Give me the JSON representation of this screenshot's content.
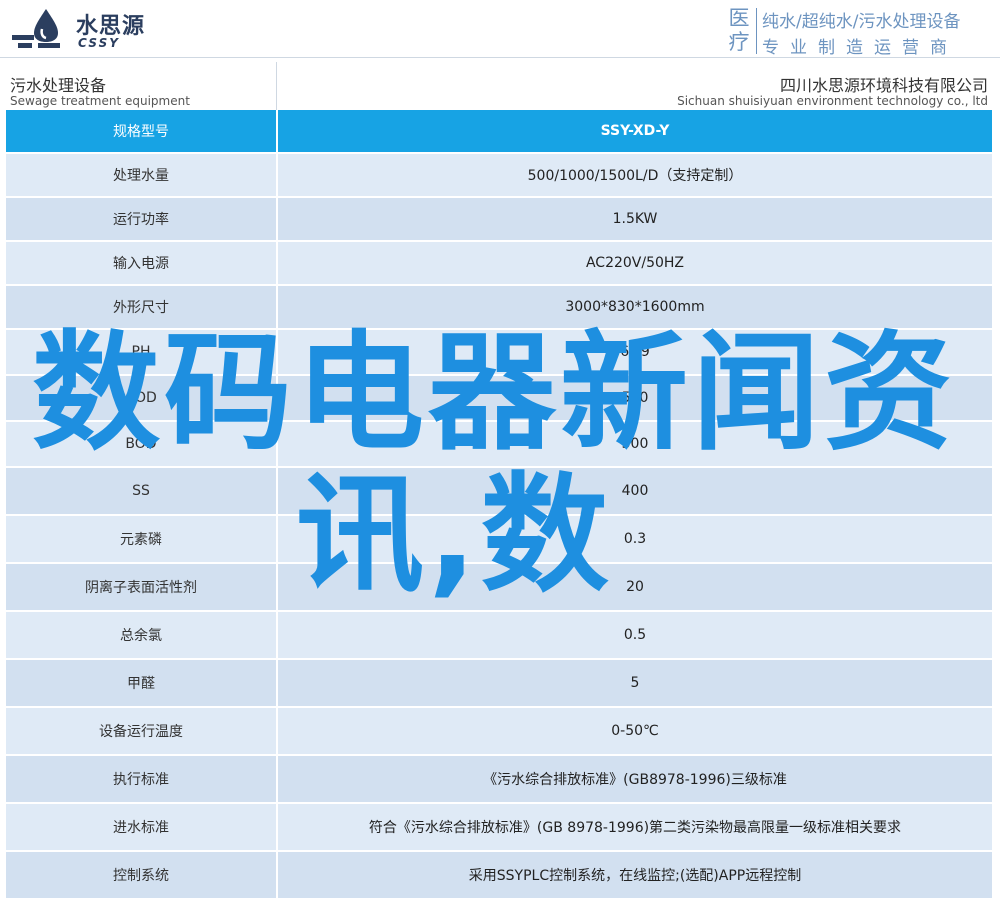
{
  "header": {
    "logo_cn": "水思源",
    "logo_en": "CSSY",
    "medical_char": "医疗",
    "slogan_line1": "纯水/超纯水/污水处理设备",
    "slogan_line2": "专业制造运营商"
  },
  "title_bar": {
    "category_cn": "污水处理设备",
    "category_en": "Sewage treatment equipment",
    "company_cn": "四川水思源环境科技有限公司",
    "company_en": "Sichuan shuisiyuan environment technology co., ltd"
  },
  "table": {
    "header": {
      "label": "规格型号",
      "value": "SSY-XD-Y"
    },
    "rows": [
      {
        "label": "处理水量",
        "value": "500/1000/1500L/D（支持定制）"
      },
      {
        "label": "运行功率",
        "value": "1.5KW"
      },
      {
        "label": "输入电源",
        "value": "AC220V/50HZ"
      },
      {
        "label": "外形尺寸",
        "value": "3000*830*1600mm"
      },
      {
        "label": "PH",
        "value": "6~9"
      },
      {
        "label": "COD",
        "value": "500"
      },
      {
        "label": "BOD",
        "value": "300"
      },
      {
        "label": "SS",
        "value": "400"
      },
      {
        "label": "元素磷",
        "value": "0.3"
      },
      {
        "label": "阴离子表面活性剂",
        "value": "20"
      },
      {
        "label": "总余氯",
        "value": "0.5"
      },
      {
        "label": "甲醛",
        "value": "5"
      },
      {
        "label": "设备运行温度",
        "value": "0-50℃"
      },
      {
        "label": "执行标准",
        "value": "《污水综合排放标准》(GB8978-1996)三级标准"
      },
      {
        "label": "进水标准",
        "value": "符合《污水综合排放标准》(GB 8978-1996)第二类污染物最高限量一级标准相关要求"
      },
      {
        "label": "控制系统",
        "value": "采用SSYPLC控制系统，在线监控;(选配)APP远程控制"
      }
    ]
  },
  "overlay": {
    "line1": "数码电器新闻资",
    "line2": "讯,数"
  },
  "colors": {
    "header_blue": "#17a3e4",
    "row_light": "#dfeaf6",
    "row_dark": "#d2e0f0",
    "overlay_text": "#1e8fe0",
    "logo_navy": "#2b3e5f",
    "slogan_blue": "#6d94c0"
  }
}
